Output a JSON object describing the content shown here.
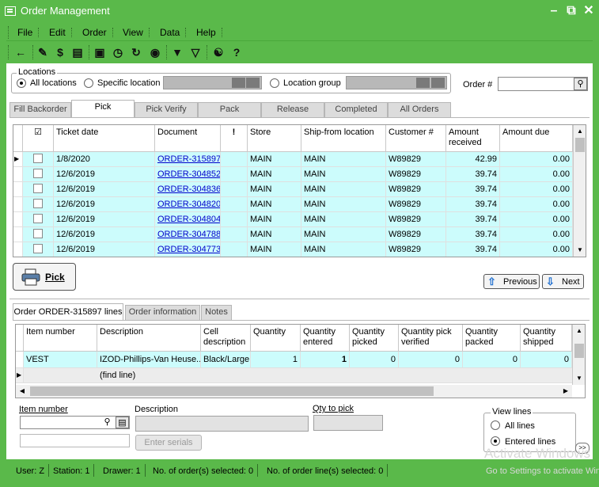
{
  "window": {
    "title": "Order Management"
  },
  "menu": [
    "File",
    "Edit",
    "Order",
    "View",
    "Data",
    "Help"
  ],
  "locations": {
    "legend": "Locations",
    "all": "All locations",
    "specific": "Specific location",
    "group": "Location group",
    "selected": "all"
  },
  "order_search": {
    "label": "Order #",
    "value": ""
  },
  "tabs": [
    "Fill Backorder",
    "Pick",
    "Pick Verify",
    "Pack",
    "Release",
    "Completed",
    "All Orders"
  ],
  "active_tab": "Pick",
  "orders": {
    "columns": [
      "",
      "Ticket date",
      "Document",
      "!",
      "Store",
      "Ship-from location",
      "Customer #",
      "Amount received",
      "Amount due"
    ],
    "rows": [
      {
        "date": "1/8/2020",
        "doc": "ORDER-315897",
        "store": "MAIN",
        "ship": "MAIN",
        "cust": "W89829",
        "received": "42.99",
        "due": "0.00"
      },
      {
        "date": "12/6/2019",
        "doc": "ORDER-304852",
        "store": "MAIN",
        "ship": "MAIN",
        "cust": "W89829",
        "received": "39.74",
        "due": "0.00"
      },
      {
        "date": "12/6/2019",
        "doc": "ORDER-304836",
        "store": "MAIN",
        "ship": "MAIN",
        "cust": "W89829",
        "received": "39.74",
        "due": "0.00"
      },
      {
        "date": "12/6/2019",
        "doc": "ORDER-304820",
        "store": "MAIN",
        "ship": "MAIN",
        "cust": "W89829",
        "received": "39.74",
        "due": "0.00"
      },
      {
        "date": "12/6/2019",
        "doc": "ORDER-304804",
        "store": "MAIN",
        "ship": "MAIN",
        "cust": "W89829",
        "received": "39.74",
        "due": "0.00"
      },
      {
        "date": "12/6/2019",
        "doc": "ORDER-304788",
        "store": "MAIN",
        "ship": "MAIN",
        "cust": "W89829",
        "received": "39.74",
        "due": "0.00"
      },
      {
        "date": "12/6/2019",
        "doc": "ORDER-304773",
        "store": "MAIN",
        "ship": "MAIN",
        "cust": "W89829",
        "received": "39.74",
        "due": "0.00"
      }
    ]
  },
  "buttons": {
    "pick": "Pick",
    "previous": "Previous",
    "next": "Next",
    "enter_serials": "Enter serials"
  },
  "subtabs": [
    "Order ORDER-315897 lines",
    "Order information",
    "Notes"
  ],
  "lines": {
    "columns": [
      "Item number",
      "Description",
      "Cell description",
      "Quantity",
      "Quantity entered",
      "Quantity picked",
      "Quantity pick verified",
      "Quantity packed",
      "Quantity shipped"
    ],
    "rows": [
      {
        "item": "VEST",
        "desc": "IZOD-Phillips-Van Heuse...",
        "cell": "Black/Large",
        "qty": "1",
        "entered": "1",
        "picked": "0",
        "verified": "0",
        "packed": "0",
        "shipped": "0"
      }
    ],
    "find_line": "(find line)"
  },
  "entry": {
    "item_label": "Item number",
    "desc_label": "Description",
    "qty_label": "Qty to pick"
  },
  "view_lines": {
    "legend": "View lines",
    "all": "All lines",
    "entered": "Entered lines",
    "selected": "entered"
  },
  "status": {
    "user": "User: Z",
    "station": "Station: 1",
    "drawer": "Drawer: 1",
    "orders_selected": "No. of order(s) selected: 0",
    "lines_selected": "No. of order line(s) selected: 0"
  },
  "watermark": {
    "line1": "Activate Windows",
    "line2": "Go to Settings to activate Windows."
  },
  "colors": {
    "chrome": "#5ab94a",
    "row_highlight": "#ccfcfc",
    "link": "#0000cc"
  }
}
